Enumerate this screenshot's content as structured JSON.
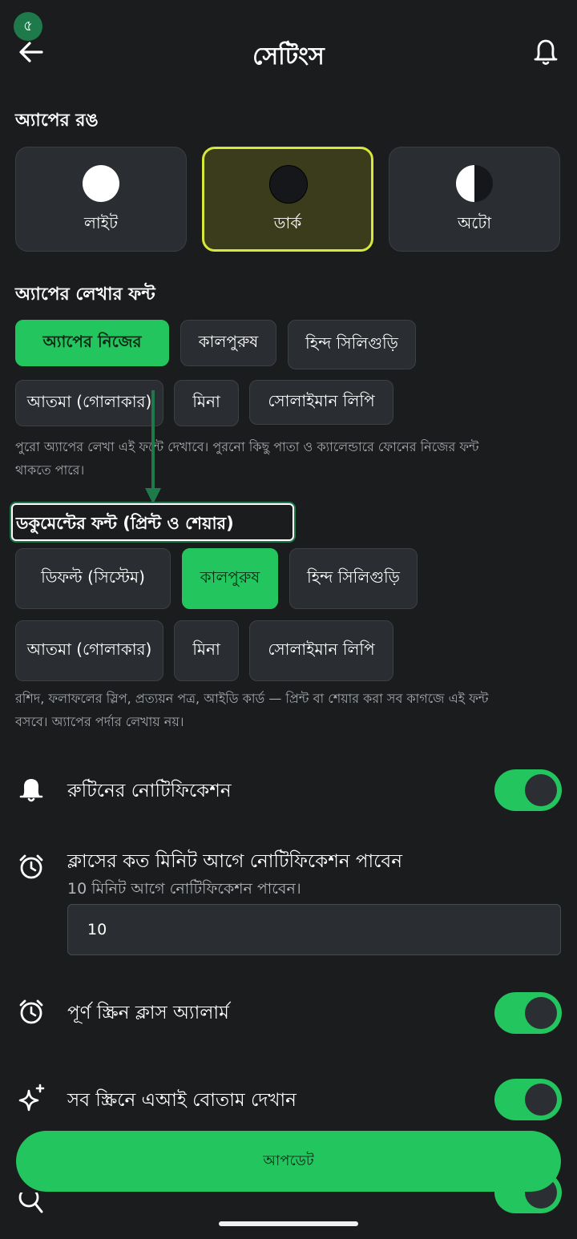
{
  "status": {
    "badge": "৫"
  },
  "header": {
    "title": "সেটিংস"
  },
  "app_color": {
    "title": "অ্যাপের রঙ",
    "options": [
      {
        "label": "লাইট",
        "selected": false
      },
      {
        "label": "ডার্ক",
        "selected": true
      },
      {
        "label": "অটো",
        "selected": false
      }
    ]
  },
  "app_font": {
    "title": "অ্যাপের লেখার ফন্ট",
    "options": [
      "অ্যাপের নিজের",
      "কালপুরুষ",
      "হিন্দ সিলিগুড়ি",
      "আতমা (গোলাকার)",
      "মিনা",
      "সোলাইমান লিপি"
    ],
    "selected": "অ্যাপের নিজের",
    "hint_line1": "পুরো অ্যাপের লেখা এই ফন্টে দেখাবে। পুরনো কিছু পাতা ও ক্যালেন্ডারে ফোনের নিজের ফন্ট",
    "hint_line2": "থাকতে পারে।"
  },
  "doc_font": {
    "title": "ডকুমেন্টের ফন্ট (প্রিন্ট ও শেয়ার)",
    "options": [
      "ডিফল্ট (সিস্টেম)",
      "কালপুরুষ",
      "হিন্দ সিলিগুড়ি",
      "আতমা (গোলাকার)",
      "মিনা",
      "সোলাইমান লিপি"
    ],
    "selected": "কালপুরুষ",
    "hint_line1": "রশিদ, ফলাফলের স্লিপ, প্রত্যয়ন পত্র, আইডি কার্ড — প্রিন্ট বা শেয়ার করা সব কাগজে এই ফন্ট",
    "hint_line2": "বসবে। অ্যাপের পর্দার লেখায় নয়।"
  },
  "settings": {
    "routine_notification": {
      "label": "রুটিনের নোটিফিকেশন",
      "on": true
    },
    "class_minutes": {
      "label": "ক্লাসের কত মিনিট আগে নোটিফিকেশন পাবেন",
      "sub": "10 মিনিট আগে নোটিফিকেশন পাবেন।",
      "value": "10"
    },
    "full_screen_alarm": {
      "label": "পূর্ণ স্ক্রিন ক্লাস অ্যালার্ম",
      "on": true
    },
    "ai_button": {
      "label": "সব স্ক্রিনে এআই বোতাম দেখান",
      "on": true
    }
  },
  "update_button": {
    "label": "আপডেট"
  },
  "colors": {
    "accent": "#22c55e",
    "selected_theme_border": "#d6e83a",
    "background": "#1a1c1e"
  },
  "icons": [
    "back-arrow-icon",
    "bell-icon",
    "alarm-clock-icon",
    "sparkle-icon",
    "search-icon"
  ]
}
